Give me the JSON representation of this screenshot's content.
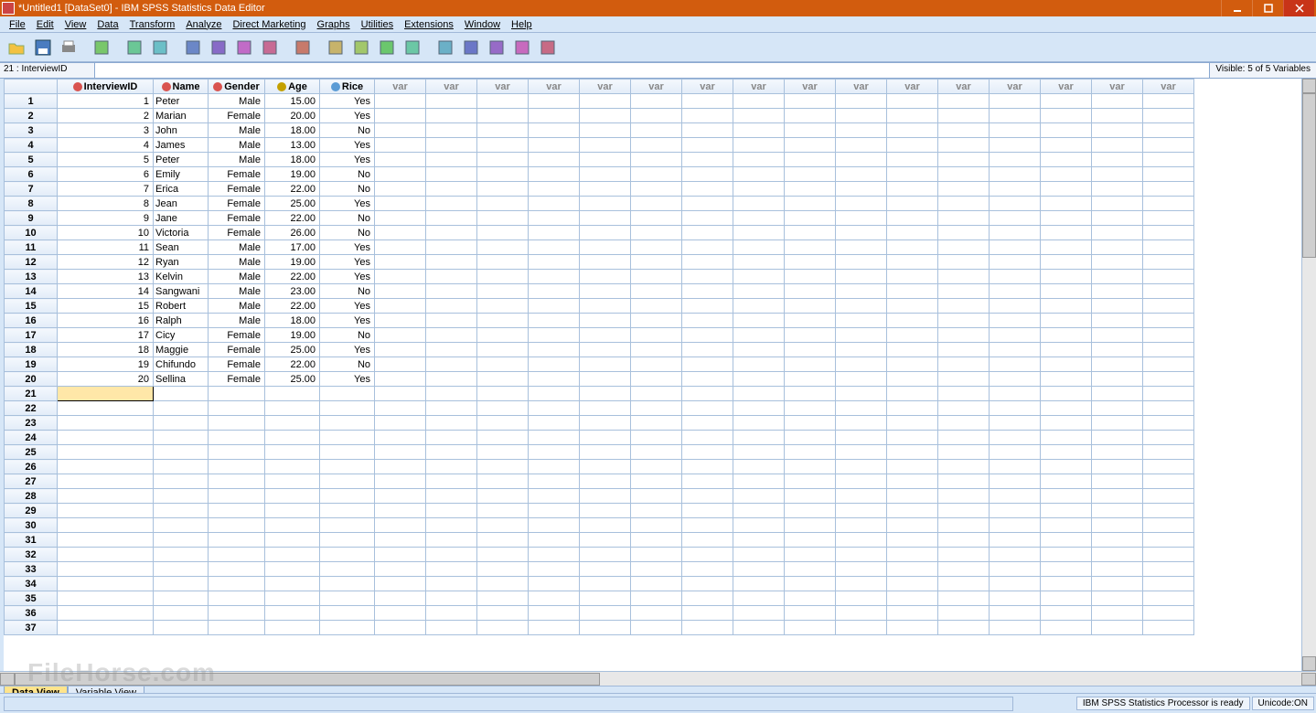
{
  "window": {
    "title": "*Untitled1 [DataSet0] - IBM SPSS Statistics Data Editor"
  },
  "menu": [
    "File",
    "Edit",
    "View",
    "Data",
    "Transform",
    "Analyze",
    "Direct Marketing",
    "Graphs",
    "Utilities",
    "Extensions",
    "Window",
    "Help"
  ],
  "toolbar_icons": [
    "open",
    "save",
    "print",
    "recall-dialog",
    "undo",
    "redo",
    "goto-case",
    "goto-var",
    "variables",
    "run",
    "find",
    "insert-case",
    "split-file",
    "weight",
    "select-cases",
    "value-labels",
    "use-sets",
    "show-all",
    "customize",
    "spell"
  ],
  "cellbar": {
    "ref": "21 : InterviewID",
    "value": "",
    "visible": "Visible: 5 of 5 Variables"
  },
  "columns": [
    {
      "name": "InterviewID",
      "icon": "nominal",
      "w": "c-id"
    },
    {
      "name": "Name",
      "icon": "nominal",
      "w": "c-name"
    },
    {
      "name": "Gender",
      "icon": "nominal",
      "w": "c-gender"
    },
    {
      "name": "Age",
      "icon": "scale",
      "w": "c-age"
    },
    {
      "name": "Rice",
      "icon": "ordinal",
      "w": "c-rice"
    }
  ],
  "var_col_count": 16,
  "var_label": "var",
  "rows": [
    {
      "n": 1,
      "id": "1",
      "name": "Peter",
      "gender": "Male",
      "age": "15.00",
      "rice": "Yes"
    },
    {
      "n": 2,
      "id": "2",
      "name": "Marian",
      "gender": "Female",
      "age": "20.00",
      "rice": "Yes"
    },
    {
      "n": 3,
      "id": "3",
      "name": "John",
      "gender": "Male",
      "age": "18.00",
      "rice": "No"
    },
    {
      "n": 4,
      "id": "4",
      "name": "James",
      "gender": "Male",
      "age": "13.00",
      "rice": "Yes"
    },
    {
      "n": 5,
      "id": "5",
      "name": "Peter",
      "gender": "Male",
      "age": "18.00",
      "rice": "Yes"
    },
    {
      "n": 6,
      "id": "6",
      "name": "Emily",
      "gender": "Female",
      "age": "19.00",
      "rice": "No"
    },
    {
      "n": 7,
      "id": "7",
      "name": "Erica",
      "gender": "Female",
      "age": "22.00",
      "rice": "No"
    },
    {
      "n": 8,
      "id": "8",
      "name": "Jean",
      "gender": "Female",
      "age": "25.00",
      "rice": "Yes"
    },
    {
      "n": 9,
      "id": "9",
      "name": "Jane",
      "gender": "Female",
      "age": "22.00",
      "rice": "No"
    },
    {
      "n": 10,
      "id": "10",
      "name": "Victoria",
      "gender": "Female",
      "age": "26.00",
      "rice": "No"
    },
    {
      "n": 11,
      "id": "11",
      "name": "Sean",
      "gender": "Male",
      "age": "17.00",
      "rice": "Yes"
    },
    {
      "n": 12,
      "id": "12",
      "name": "Ryan",
      "gender": "Male",
      "age": "19.00",
      "rice": "Yes"
    },
    {
      "n": 13,
      "id": "13",
      "name": "Kelvin",
      "gender": "Male",
      "age": "22.00",
      "rice": "Yes"
    },
    {
      "n": 14,
      "id": "14",
      "name": "Sangwani",
      "gender": "Male",
      "age": "23.00",
      "rice": "No"
    },
    {
      "n": 15,
      "id": "15",
      "name": "Robert",
      "gender": "Male",
      "age": "22.00",
      "rice": "Yes"
    },
    {
      "n": 16,
      "id": "16",
      "name": "Ralph",
      "gender": "Male",
      "age": "18.00",
      "rice": "Yes"
    },
    {
      "n": 17,
      "id": "17",
      "name": "Cicy",
      "gender": "Female",
      "age": "19.00",
      "rice": "No"
    },
    {
      "n": 18,
      "id": "18",
      "name": "Maggie",
      "gender": "Female",
      "age": "25.00",
      "rice": "Yes"
    },
    {
      "n": 19,
      "id": "19",
      "name": "Chifundo",
      "gender": "Female",
      "age": "22.00",
      "rice": "No"
    },
    {
      "n": 20,
      "id": "20",
      "name": "Sellina",
      "gender": "Female",
      "age": "25.00",
      "rice": "Yes"
    }
  ],
  "empty_rows_start": 21,
  "empty_rows_end": 37,
  "selected_cell": {
    "row": 21,
    "col": 0
  },
  "viewtabs": {
    "active": "Data View",
    "other": "Variable View"
  },
  "status": {
    "processor": "IBM SPSS Statistics Processor is ready",
    "unicode": "Unicode:ON"
  },
  "watermark": "FileHorse.com"
}
